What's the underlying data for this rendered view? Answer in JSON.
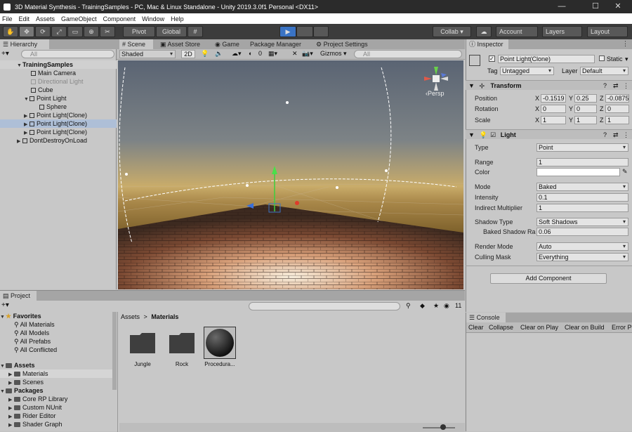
{
  "window": {
    "title": "3D Material Synthesis - TrainingSamples - PC, Mac & Linux Standalone - Unity 2019.3.0f1 Personal <DX11>",
    "minimize": "—",
    "maximize": "☐",
    "close": "✕"
  },
  "menu": [
    "File",
    "Edit",
    "Assets",
    "GameObject",
    "Component",
    "Window",
    "Help"
  ],
  "toolbar": {
    "pivot": "Pivot",
    "global": "Global",
    "collab": "Collab ▾",
    "account": "Account",
    "layers": "Layers",
    "layout": "Layout"
  },
  "hierarchy": {
    "tab": "Hierarchy",
    "search": "All",
    "items": [
      {
        "label": "TrainingSamples",
        "level": 0,
        "bold": true,
        "dim": false
      },
      {
        "label": "Main Camera",
        "level": 1,
        "dim": false
      },
      {
        "label": "Directional Light",
        "level": 1,
        "dim": true
      },
      {
        "label": "Cube",
        "level": 1,
        "dim": false
      },
      {
        "label": "Point Light",
        "level": 1,
        "dim": false
      },
      {
        "label": "Sphere",
        "level": 2,
        "dim": false
      },
      {
        "label": "Point Light(Clone)",
        "level": 1,
        "dim": false
      },
      {
        "label": "Point Light(Clone)",
        "level": 1,
        "dim": false
      },
      {
        "label": "Point Light(Clone)",
        "level": 1,
        "dim": false
      },
      {
        "label": "DontDestroyOnLoad",
        "level": 0,
        "dim": false
      }
    ]
  },
  "scene": {
    "tabs": [
      "Scene",
      "Asset Store",
      "Game",
      "Package Manager",
      "Project Settings"
    ],
    "shading": "Shaded",
    "mode2d": "2D",
    "fx_count": "0",
    "gizmos": "Gizmos",
    "search": "All",
    "persp": "Persp"
  },
  "inspector": {
    "tab": "Inspector",
    "object_name": "Point Light(Clone)",
    "static": "Static",
    "tag_label": "Tag",
    "tag": "Untagged",
    "layer_label": "Layer",
    "layer": "Default",
    "transform": {
      "title": "Transform",
      "position_label": "Position",
      "rotation_label": "Rotation",
      "scale_label": "Scale",
      "position": {
        "x": "-0.1519",
        "y": "0.25",
        "z": "-0.0875"
      },
      "rotation": {
        "x": "0",
        "y": "0",
        "z": "0"
      },
      "scale": {
        "x": "1",
        "y": "1",
        "z": "1"
      }
    },
    "light": {
      "title": "Light",
      "type_label": "Type",
      "type": "Point",
      "range_label": "Range",
      "range": "1",
      "color_label": "Color",
      "mode_label": "Mode",
      "mode": "Baked",
      "intensity_label": "Intensity",
      "intensity": "0.1",
      "indirect_label": "Indirect Multiplier",
      "indirect": "1",
      "shadow_label": "Shadow Type",
      "shadow": "Soft Shadows",
      "baked_shadow_label": "Baked Shadow Ra",
      "baked_shadow": "0.06",
      "render_mode_label": "Render Mode",
      "render_mode": "Auto",
      "culling_label": "Culling Mask",
      "culling": "Everything"
    },
    "add_component": "Add Component"
  },
  "console": {
    "tab": "Console",
    "buttons": [
      "Clear",
      "Collapse",
      "Clear on Play",
      "Clear on Build",
      "Error P"
    ]
  },
  "project": {
    "tab": "Project",
    "count": "11",
    "tree": [
      {
        "label": "Favorites",
        "level": 0,
        "bold": true
      },
      {
        "label": "All Materials",
        "level": 1
      },
      {
        "label": "All Models",
        "level": 1
      },
      {
        "label": "All Prefabs",
        "level": 1
      },
      {
        "label": "All Conflicted",
        "level": 1
      },
      {
        "label": "Assets",
        "level": 0,
        "bold": true
      },
      {
        "label": "Materials",
        "level": 1
      },
      {
        "label": "Scenes",
        "level": 1
      },
      {
        "label": "Packages",
        "level": 0,
        "bold": true
      },
      {
        "label": "Core RP Library",
        "level": 1
      },
      {
        "label": "Custom NUnit",
        "level": 1
      },
      {
        "label": "Rider Editor",
        "level": 1
      },
      {
        "label": "Shader Graph",
        "level": 1
      }
    ],
    "breadcrumb_root": "Assets",
    "breadcrumb_sep": ">",
    "breadcrumb_current": "Materials",
    "assets": [
      "Jungle",
      "Rock",
      "Procedura..."
    ]
  },
  "colors": {
    "accent_play": "#3a73c4",
    "selection": "#aebfd7"
  }
}
